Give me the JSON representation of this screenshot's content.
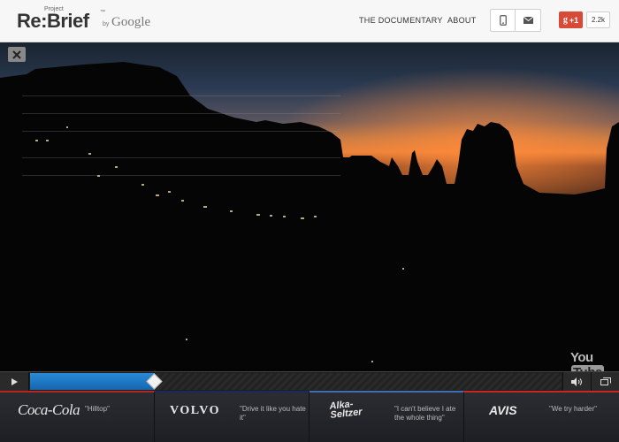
{
  "header": {
    "logo_project": "Project",
    "logo_main": "Re:Brief",
    "logo_tm": "™",
    "logo_by": "by",
    "logo_google": "Google",
    "nav": [
      {
        "label": "THE DOCUMENTARY"
      },
      {
        "label": "ABOUT"
      }
    ],
    "share_icons": [
      "phone-icon",
      "mail-icon"
    ],
    "gplus_label": "+1",
    "gplus_count": "2.2k"
  },
  "video": {
    "close_icon": "close-icon",
    "youtube_you": "You",
    "youtube_tube": "Tube"
  },
  "player": {
    "progress": 0.235,
    "play_icon": "play-icon",
    "volume_icon": "volume-icon",
    "fullscreen_icon": "fullscreen-icon"
  },
  "brands": [
    {
      "logo": "Coca-Cola",
      "quote": "\"Hilltop\""
    },
    {
      "logo": "VOLVO",
      "quote": "\"Drive it like you hate it\""
    },
    {
      "logo_line1": "Alka-",
      "logo_line2": "Seltzer",
      "quote": "\"I can't believe I ate the whole thing\""
    },
    {
      "logo": "AVIS",
      "quote": "\"We try harder\""
    }
  ],
  "colors": {
    "accent_blue": "#1e7ad0",
    "gplus_red": "#d84a38",
    "header_bg": "#f7f7f7"
  }
}
